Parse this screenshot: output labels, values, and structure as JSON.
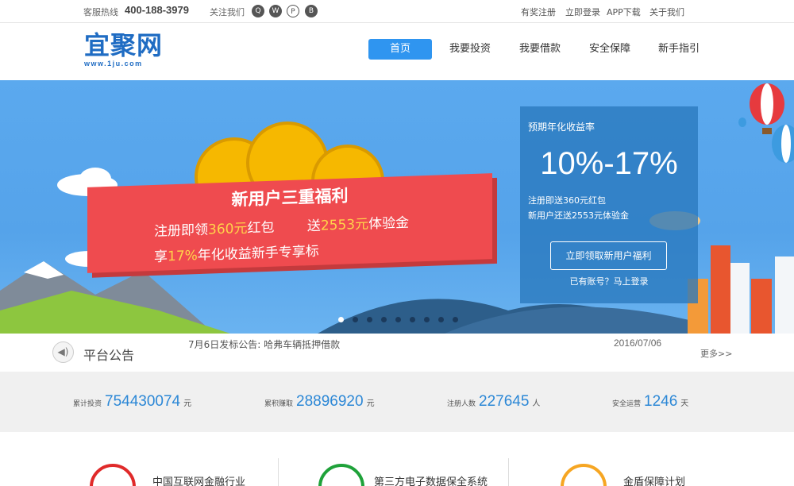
{
  "topbar": {
    "hotline_label": "客服热线",
    "hotline_number": "400-188-3979",
    "follow_label": "关注我们",
    "links": [
      "有奖注册",
      "立即登录",
      "APP下载",
      "关于我们"
    ]
  },
  "logo": {
    "mark": "宜聚网",
    "url": "www.1ju.com"
  },
  "nav": [
    "首页",
    "我要投资",
    "我要借款",
    "安全保障",
    "新手指引"
  ],
  "banner": {
    "ribbon_title": "新用户三重福利",
    "line1_pre": "注册即领",
    "line1_hl": "360元",
    "line1_post": "红包",
    "line1b_pre": "送",
    "line1b_hl": "2553元",
    "line1b_post": "体验金",
    "line2_pre": "享",
    "line2_hl": "17%",
    "line2_post": "年化收益新手专享标"
  },
  "panel": {
    "title": "预期年化收益率",
    "rate": "10%-17%",
    "desc1": "注册即送360元红包",
    "desc2": "新用户还送2553元体验金",
    "button": "立即领取新用户福利",
    "login_hint": "已有账号？马上登录"
  },
  "notice": {
    "label": "平台公告",
    "text": "7月6日发标公告: 哈弗车辆抵押借款",
    "date": "2016/07/06",
    "more": "更多>>"
  },
  "stats": [
    {
      "label": "累计投资",
      "value": "754430074",
      "unit": "元"
    },
    {
      "label": "累积赚取",
      "value": "28896920",
      "unit": "元"
    },
    {
      "label": "注册人数",
      "value": "227645",
      "unit": "人"
    },
    {
      "label": "安全运营",
      "value": "1246",
      "unit": "天"
    }
  ],
  "features": [
    {
      "text": "中国互联网金融行业"
    },
    {
      "text": "第三方电子数据保全系统"
    },
    {
      "text": "金盾保障计划"
    }
  ],
  "colors": {
    "accent": "#2f95f0",
    "ribbon": "#ef4b4f",
    "stat_number": "#2b87d6"
  }
}
